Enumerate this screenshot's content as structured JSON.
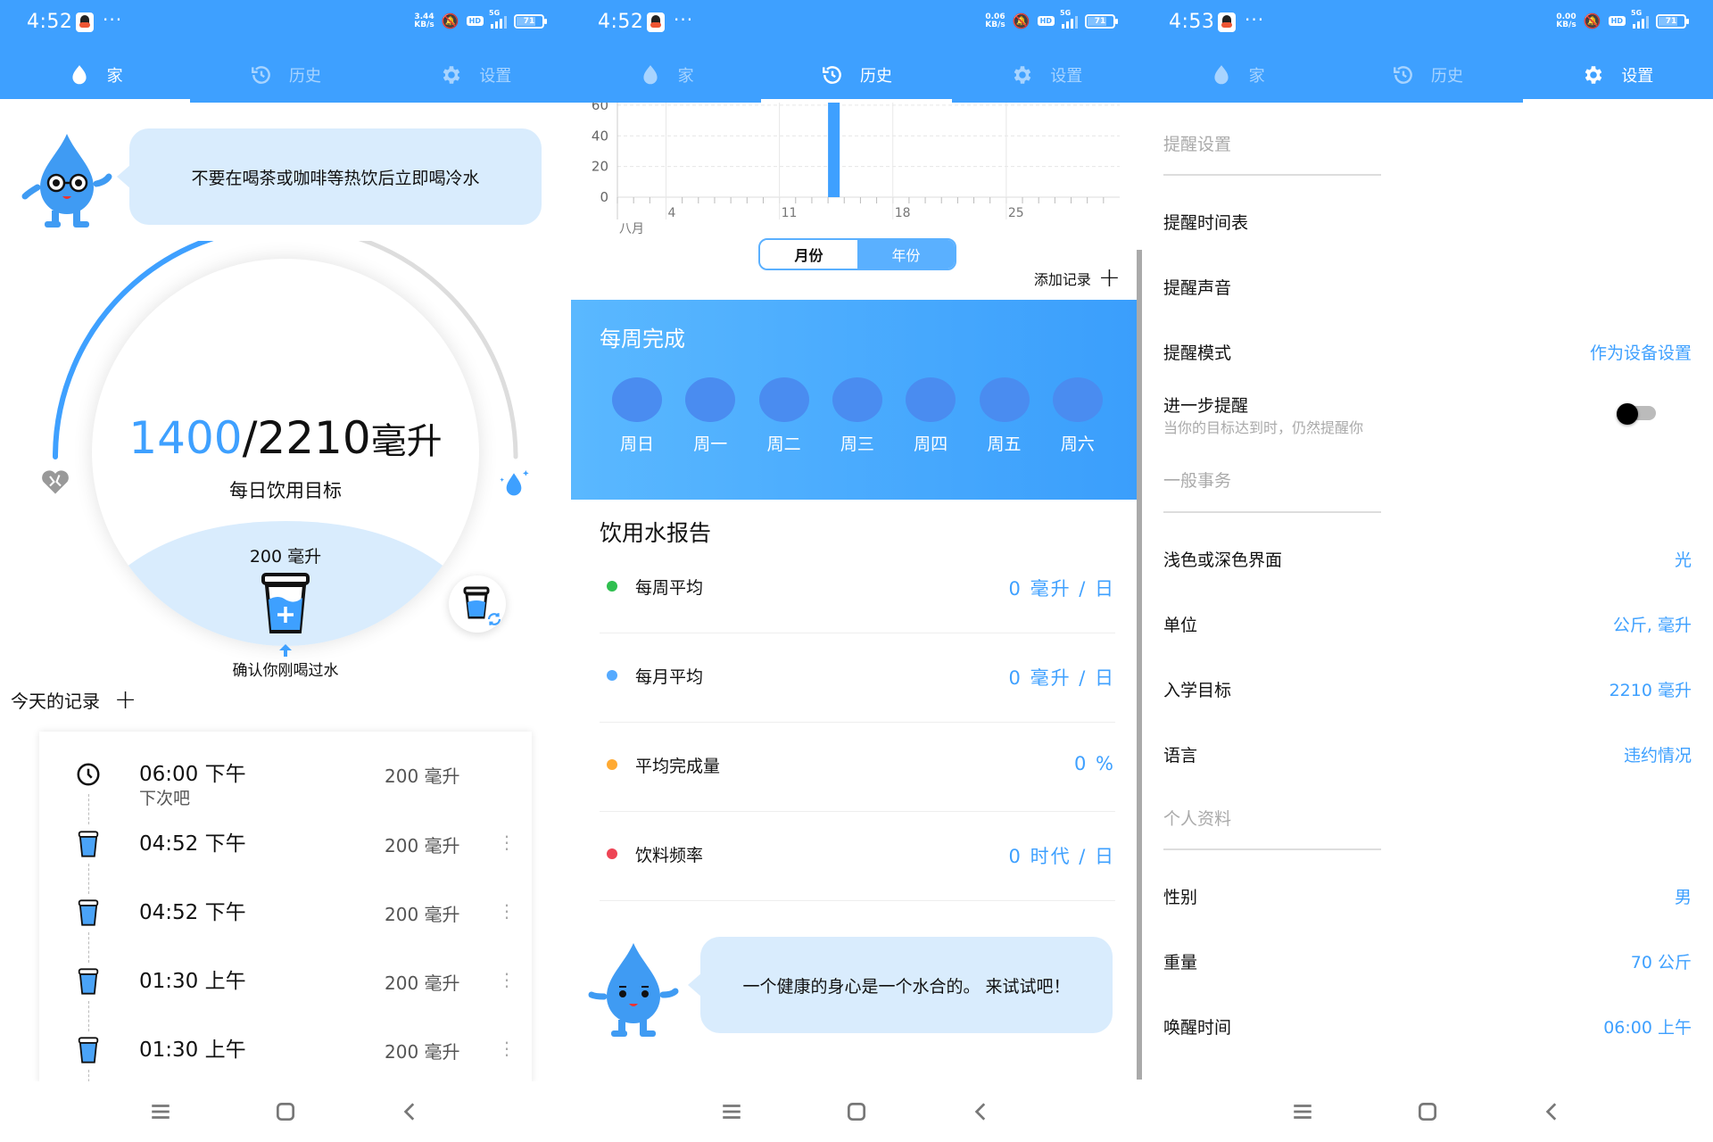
{
  "colors": {
    "primary": "#3ea0ff",
    "bubble": "#d9ecfd",
    "green": "#2fbf4f",
    "blue": "#55aaff",
    "orange": "#ffaa33",
    "red": "#ee4455"
  },
  "screens": [
    {
      "status": {
        "time": "4:52",
        "dots": "···",
        "netspeed_value": "3.44",
        "netspeed_unit": "KB/s",
        "network": "5G",
        "battery": "71",
        "battery_level": 0.71
      },
      "tabs": [
        {
          "label": "家",
          "icon": "water-drop-icon"
        },
        {
          "label": "历史",
          "icon": "history-icon"
        },
        {
          "label": "设置",
          "icon": "gear-icon"
        }
      ],
      "active_tab": 0,
      "tip": "不要在喝茶或咖啡等热饮后立即喝冷水",
      "progress": {
        "current": "1400",
        "goal": "/2210",
        "unit": "毫升",
        "fraction": 0.63,
        "label": "每日饮用目标"
      },
      "cup": {
        "amount": "200 毫升",
        "confirm": "确认你刚喝过水"
      },
      "records": {
        "title": "今天的记录",
        "items": [
          {
            "type": "reminder",
            "time": "06:00 下午",
            "sub": "下次吧",
            "amount": "200 毫升"
          },
          {
            "type": "cup",
            "time": "04:52 下午",
            "amount": "200 毫升"
          },
          {
            "type": "cup",
            "time": "04:52 下午",
            "amount": "200 毫升"
          },
          {
            "type": "cup",
            "time": "01:30 上午",
            "amount": "200 毫升"
          },
          {
            "type": "cup",
            "time": "01:30 上午",
            "amount": "200 毫升"
          }
        ]
      }
    },
    {
      "status": {
        "time": "4:52",
        "dots": "···",
        "netspeed_value": "0.06",
        "netspeed_unit": "KB/s",
        "network": "5G",
        "battery": "71",
        "battery_level": 0.71
      },
      "tabs": [
        {
          "label": "家",
          "icon": "water-drop-icon"
        },
        {
          "label": "历史",
          "icon": "history-icon"
        },
        {
          "label": "设置",
          "icon": "gear-icon"
        }
      ],
      "active_tab": 1,
      "segment": {
        "month": "月份",
        "year": "年份",
        "selected": "月份"
      },
      "add_record": "添加记录",
      "weekly": {
        "title": "每周完成",
        "days": [
          "周日",
          "周一",
          "周二",
          "周三",
          "周四",
          "周五",
          "周六"
        ]
      },
      "report": {
        "title": "饮用水报告",
        "items": [
          {
            "label": "每周平均",
            "value": "0 毫升 / 日",
            "color": "#2fbf4f"
          },
          {
            "label": "每月平均",
            "value": "0 毫升 / 日",
            "color": "#55aaff"
          },
          {
            "label": "平均完成量",
            "value": "0 %",
            "color": "#ffaa33"
          },
          {
            "label": "饮料频率",
            "value": "0 时代 / 日",
            "color": "#ee4455"
          }
        ]
      },
      "footer_tip": "一个健康的身心是一个水合的。 来试试吧！"
    },
    {
      "status": {
        "time": "4:53",
        "dots": "···",
        "netspeed_value": "0.00",
        "netspeed_unit": "KB/s",
        "network": "5G",
        "battery": "71",
        "battery_level": 0.71
      },
      "tabs": [
        {
          "label": "家",
          "icon": "water-drop-icon"
        },
        {
          "label": "历史",
          "icon": "history-icon"
        },
        {
          "label": "设置",
          "icon": "gear-icon"
        }
      ],
      "active_tab": 2,
      "settings": {
        "reminder_section": "提醒设置",
        "schedule": "提醒时间表",
        "sound": "提醒声音",
        "mode": {
          "label": "提醒模式",
          "value": "作为设备设置"
        },
        "further": {
          "label": "进一步提醒",
          "sub": "当你的目标达到时，仍然提醒你",
          "on": false
        },
        "general_section": "一般事务",
        "theme": {
          "label": "浅色或深色界面",
          "value": "光"
        },
        "units": {
          "label": "单位",
          "value": "公斤, 毫升"
        },
        "goal": {
          "label": "入学目标",
          "value": "2210 毫升"
        },
        "language": {
          "label": "语言",
          "value": "违约情况"
        },
        "profile_section": "个人资料",
        "gender": {
          "label": "性别",
          "value": "男"
        },
        "weight": {
          "label": "重量",
          "value": "70 公斤"
        },
        "wake": {
          "label": "唤醒时间",
          "value": "06:00 上午"
        }
      }
    }
  ],
  "chart_data": {
    "type": "bar",
    "title": "",
    "xlabel": "八月",
    "ylabel": "",
    "x": [
      14
    ],
    "values": [
      100
    ],
    "x_range": [
      1,
      31
    ],
    "x_ticks": [
      "4",
      "11",
      "18",
      "25"
    ],
    "x_tick_values": [
      4,
      11,
      18,
      25
    ],
    "y_ticks": [
      "0",
      "20",
      "40",
      "60"
    ],
    "y_tick_values": [
      0,
      20,
      40,
      60
    ],
    "ylim": [
      0,
      60
    ],
    "grid": true,
    "note": "bar at day 14 exceeds visible range (clipped)"
  }
}
